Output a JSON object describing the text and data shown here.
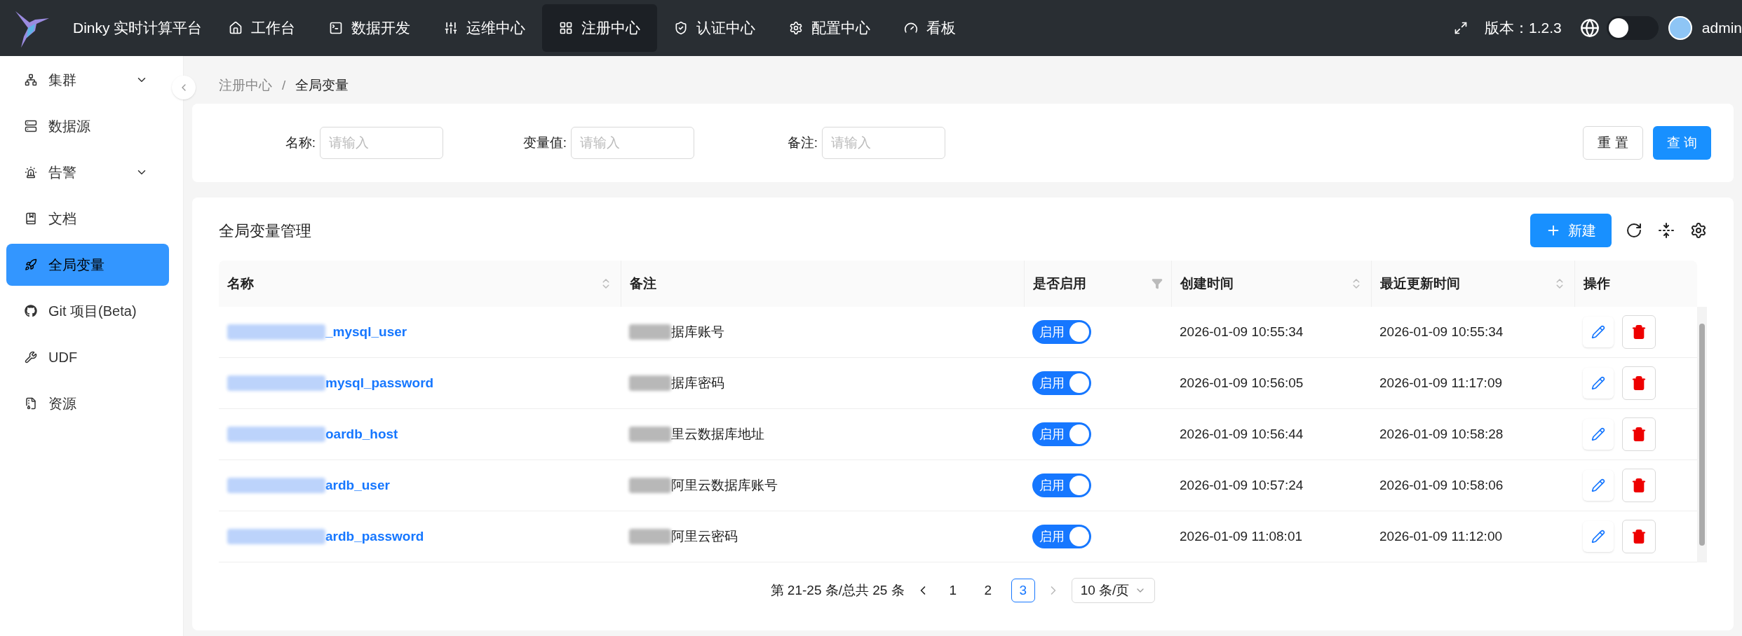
{
  "app_title": "Dinky 实时计算平台",
  "nav": [
    {
      "label": "工作台",
      "selected": false
    },
    {
      "label": "数据开发",
      "selected": false
    },
    {
      "label": "运维中心",
      "selected": false
    },
    {
      "label": "注册中心",
      "selected": true
    },
    {
      "label": "认证中心",
      "selected": false
    },
    {
      "label": "配置中心",
      "selected": false
    },
    {
      "label": "看板",
      "selected": false
    }
  ],
  "header_right": {
    "version": "版本：1.2.3",
    "theme_switch": {
      "on": false
    },
    "user": "admin"
  },
  "sidebar": {
    "items": [
      {
        "label": "集群",
        "expandable": true,
        "selected": false
      },
      {
        "label": "数据源",
        "expandable": false,
        "selected": false
      },
      {
        "label": "告警",
        "expandable": true,
        "selected": false
      },
      {
        "label": "文档",
        "expandable": false,
        "selected": false
      },
      {
        "label": "全局变量",
        "expandable": false,
        "selected": true
      },
      {
        "label": "Git 项目(Beta)",
        "expandable": false,
        "selected": false
      },
      {
        "label": "UDF",
        "expandable": false,
        "selected": false
      },
      {
        "label": "资源",
        "expandable": false,
        "selected": false
      }
    ]
  },
  "breadcrumb": {
    "items": [
      "注册中心",
      "全局变量"
    ],
    "separator": "/"
  },
  "filters": [
    {
      "label": "名称:",
      "placeholder": "请输入"
    },
    {
      "label": "变量值:",
      "placeholder": "请输入"
    },
    {
      "label": "备注:",
      "placeholder": "请输入"
    }
  ],
  "filter_buttons": [
    {
      "label": "重 置",
      "kind": "default"
    },
    {
      "label": "查 询",
      "kind": "primary"
    }
  ],
  "table": {
    "title": "全局变量管理",
    "new_button": "新建",
    "columns": [
      {
        "label": "名称",
        "kind": "sort"
      },
      {
        "label": "备注",
        "kind": "plain"
      },
      {
        "label": "是否启用",
        "kind": "filter"
      },
      {
        "label": "创建时间",
        "kind": "sort"
      },
      {
        "label": "最近更新时间",
        "kind": "sort"
      },
      {
        "label": "操作",
        "kind": "plain"
      }
    ],
    "rows": [
      {
        "name": "_mysql_user",
        "name_redacted": true,
        "note": "据库账号",
        "note_redacted": true,
        "enabled": true,
        "switch_label": "启用",
        "created": "2026-01-09 10:55:34",
        "updated": "2026-01-09 10:55:34"
      },
      {
        "name": "mysql_password",
        "name_redacted": true,
        "note": "据库密码",
        "note_redacted": true,
        "enabled": true,
        "switch_label": "启用",
        "created": "2026-01-09 10:56:05",
        "updated": "2026-01-09 11:17:09"
      },
      {
        "name": "oardb_host",
        "name_redacted": true,
        "note": "里云数据库地址",
        "note_redacted": true,
        "enabled": true,
        "switch_label": "启用",
        "created": "2026-01-09 10:56:44",
        "updated": "2026-01-09 10:58:28"
      },
      {
        "name": "ardb_user",
        "name_redacted": true,
        "note": "阿里云数据库账号",
        "note_redacted": true,
        "enabled": true,
        "switch_label": "启用",
        "created": "2026-01-09 10:57:24",
        "updated": "2026-01-09 10:58:06"
      },
      {
        "name": "ardb_password",
        "name_redacted": true,
        "note": "阿里云密码",
        "note_redacted": true,
        "enabled": true,
        "switch_label": "启用",
        "created": "2026-01-09 11:08:01",
        "updated": "2026-01-09 11:12:00"
      }
    ]
  },
  "pagination": {
    "summary": "第 21-25 条/总共 25 条",
    "pages": [
      {
        "label": "1",
        "selected": false
      },
      {
        "label": "2",
        "selected": false
      },
      {
        "label": "3",
        "selected": true
      }
    ],
    "page_size": "10 条/页"
  }
}
